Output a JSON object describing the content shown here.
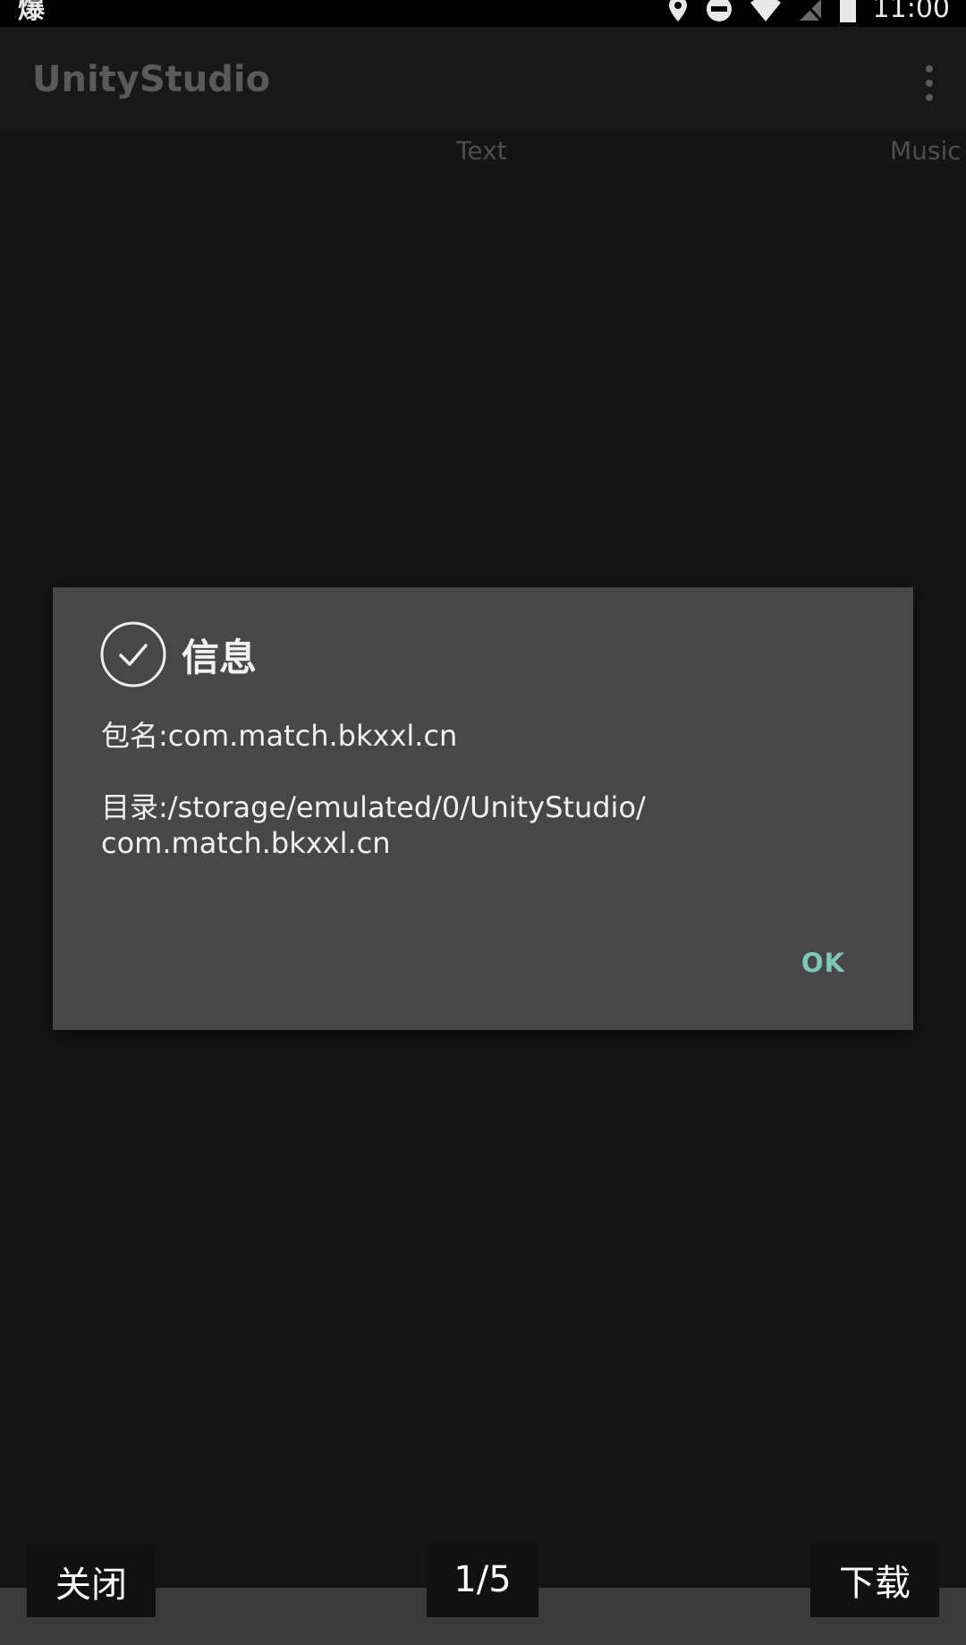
{
  "status_bar": {
    "left_icon_text": "爆",
    "time": "11:00",
    "icons": [
      "location-icon",
      "do-not-disturb-icon",
      "wifi-icon",
      "no-signal-icon",
      "battery-icon"
    ]
  },
  "app_bar": {
    "title": "UnityStudio",
    "menu_icon": "overflow-menu-icon"
  },
  "tabs": [
    {
      "label": "Text"
    },
    {
      "label": "Music"
    }
  ],
  "dialog": {
    "icon": "check-circle-icon",
    "title": "信息",
    "package_line": "包名:com.match.bkxxl.cn",
    "directory_line_1": "目录:/storage/emulated/0/UnityStudio/",
    "directory_line_2": "com.match.bkxxl.cn",
    "ok_label": "OK",
    "ok_color": "#7fc7b6"
  },
  "viewer": {
    "close_label": "关闭",
    "page_counter": "1/5",
    "download_label": "下载"
  }
}
